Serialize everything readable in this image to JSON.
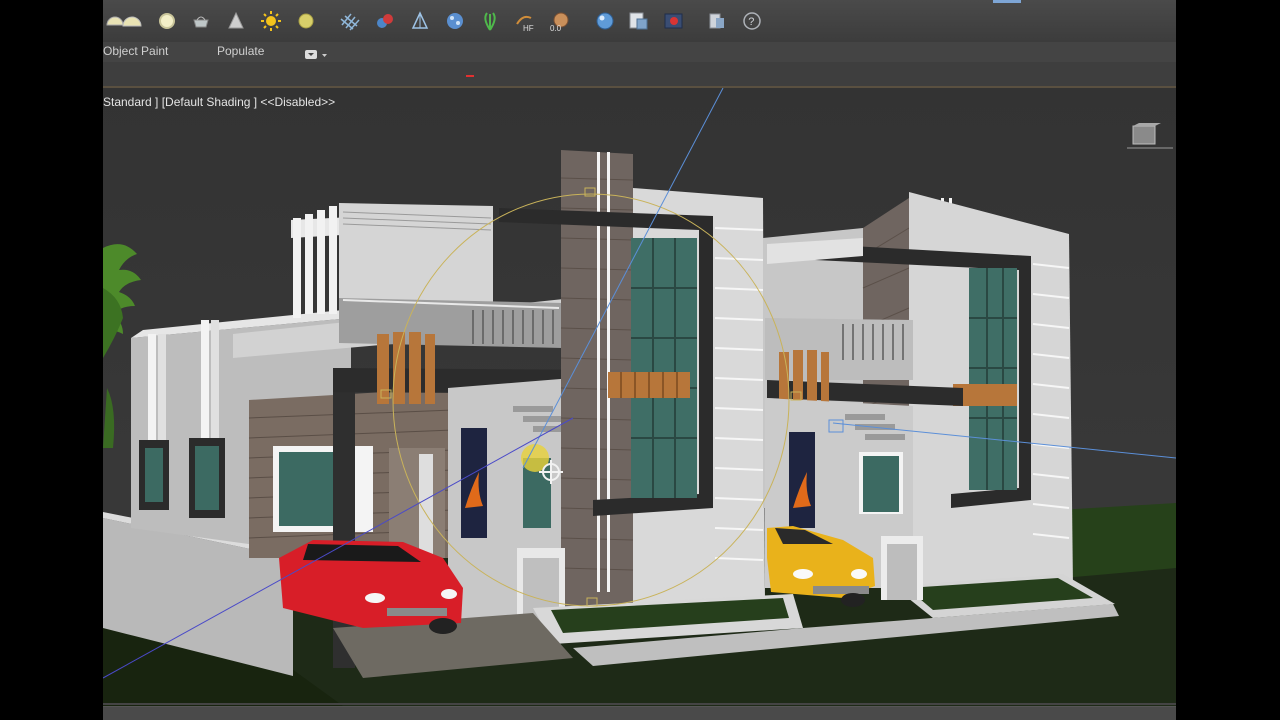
{
  "ribbon": {
    "object_paint": "Object Paint",
    "populate": "Populate"
  },
  "viewport": {
    "label": "Standard ] [Default Shading ] <<Disabled>>"
  },
  "toolbar_icons": [
    "half-sphere-icon",
    "sphere-icon",
    "teapot-icon",
    "cone-light-icon",
    "sun-icon",
    "omni-light-icon",
    "grid-icon",
    "material-icon",
    "transform-icon",
    "particle-icon",
    "plant-icon",
    "hair-fur-icon",
    "cloth-icon",
    "render-sphere-icon",
    "render-setup-icon",
    "render-frame-icon",
    "layers-icon",
    "help-icon"
  ],
  "colors": {
    "ui_bg": "#3a3a3a",
    "viewport_bg": "#363636",
    "wall_white": "#d9d9d9",
    "wall_grey": "#a8a8a8",
    "stone": "#6f6560",
    "wood": "#b7763a",
    "glass": "#3f6e66",
    "car_red": "#d81e28",
    "car_yellow": "#e9b21b",
    "lawn": "#2f4a22"
  }
}
